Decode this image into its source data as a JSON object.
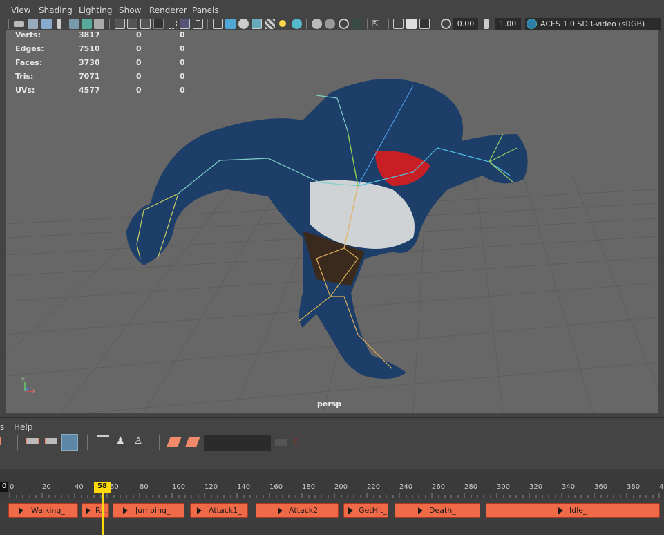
{
  "menu": [
    "View",
    "Shading",
    "Lighting",
    "Show",
    "Renderer",
    "Panels"
  ],
  "toolbar": {
    "exposure": "0.00",
    "gamma": "1.00",
    "color_space": "ACES 1.0 SDR-video (sRGB)"
  },
  "stats": [
    {
      "label": "Verts:",
      "v1": "3817",
      "v2": "0",
      "v3": "0"
    },
    {
      "label": "Edges:",
      "v1": "7510",
      "v2": "0",
      "v3": "0"
    },
    {
      "label": "Faces:",
      "v1": "3730",
      "v2": "0",
      "v3": "0"
    },
    {
      "label": "Tris:",
      "v1": "7071",
      "v2": "0",
      "v3": "0"
    },
    {
      "label": "UVs:",
      "v1": "4577",
      "v2": "0",
      "v3": "0"
    }
  ],
  "camera": "persp",
  "axis": {
    "y": "y",
    "x": "x"
  },
  "bottom_menu": {
    "left": "s",
    "help": "Help"
  },
  "time_editor": {
    "zero": "0",
    "current_frame": "58",
    "ticks": [
      "0",
      "20",
      "40",
      "60",
      "80",
      "100",
      "120",
      "140",
      "160",
      "180",
      "200",
      "220",
      "240",
      "260",
      "280",
      "300",
      "320",
      "340",
      "360",
      "380",
      "4"
    ],
    "clips": [
      "Walking_",
      "R...",
      "Jumping_",
      "Attack1_",
      "Attack2",
      "GetHit_",
      "Death_",
      "Idle_"
    ]
  },
  "icons": {
    "select": "select-icon",
    "lasso": "lasso-icon",
    "magnet": "magnet-icon",
    "key": "key-icon"
  }
}
